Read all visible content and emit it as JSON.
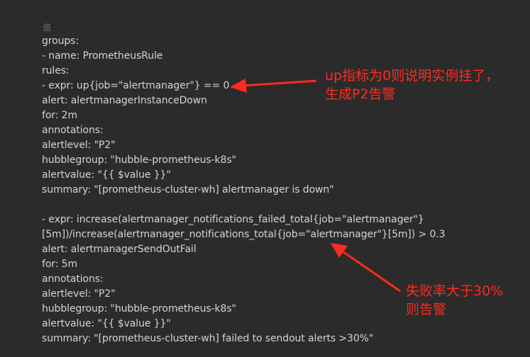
{
  "header_label": "值",
  "code_lines": [
    "groups:",
    "- name: PrometheusRule",
    "rules:",
    "- expr: up{job=\"alertmanager\"} == 0",
    "alert: alertmanagerInstanceDown",
    "for: 2m",
    "annotations:",
    "alertlevel: \"P2\"",
    "hubblegroup: \"hubble-prometheus-k8s\"",
    "alertvalue: \"{{ $value }}\"",
    "summary: \"[prometheus-cluster-wh] alertmanager is down\"",
    "",
    "- expr: increase(alertmanager_notifications_failed_total{job=\"alertmanager\"}",
    "[5m])/increase(alertmanager_notifications_total{job=\"alertmanager\"}[5m]) > 0.3",
    "alert: alertmanagerSendOutFail",
    "for: 5m",
    "annotations:",
    "alertlevel: \"P2\"",
    "hubblegroup: \"hubble-prometheus-k8s\"",
    "alertvalue: \"{{ $value }}\"",
    "summary: \"[prometheus-cluster-wh] failed to sendout alerts >30%\""
  ],
  "annotations": {
    "first": {
      "line1": "up指标为0则说明实例挂了，",
      "line2": "生成P2告警"
    },
    "second": {
      "line1": "失败率大于30%",
      "line2": "则告警"
    }
  },
  "colors": {
    "background": "#2b2b2b",
    "code_text": "#d4d4d4",
    "annotation": "#ff2a1f"
  }
}
